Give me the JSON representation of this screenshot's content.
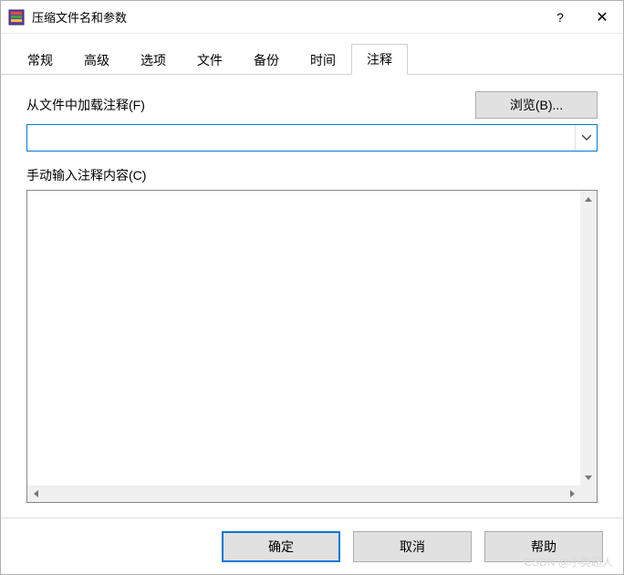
{
  "titlebar": {
    "title": "压缩文件名和参数"
  },
  "tabs": {
    "items": [
      {
        "label": "常规"
      },
      {
        "label": "高级"
      },
      {
        "label": "选项"
      },
      {
        "label": "文件"
      },
      {
        "label": "备份"
      },
      {
        "label": "时间"
      },
      {
        "label": "注释"
      }
    ],
    "active_index": 6
  },
  "content": {
    "load_from_file_label": "从文件中加载注释(F)",
    "browse_label": "浏览(B)...",
    "combo_value": "",
    "manual_label": "手动输入注释内容(C)",
    "textarea_value": ""
  },
  "footer": {
    "ok": "确定",
    "cancel": "取消",
    "help": "帮助"
  },
  "watermark": "CSDN @小奥超人"
}
